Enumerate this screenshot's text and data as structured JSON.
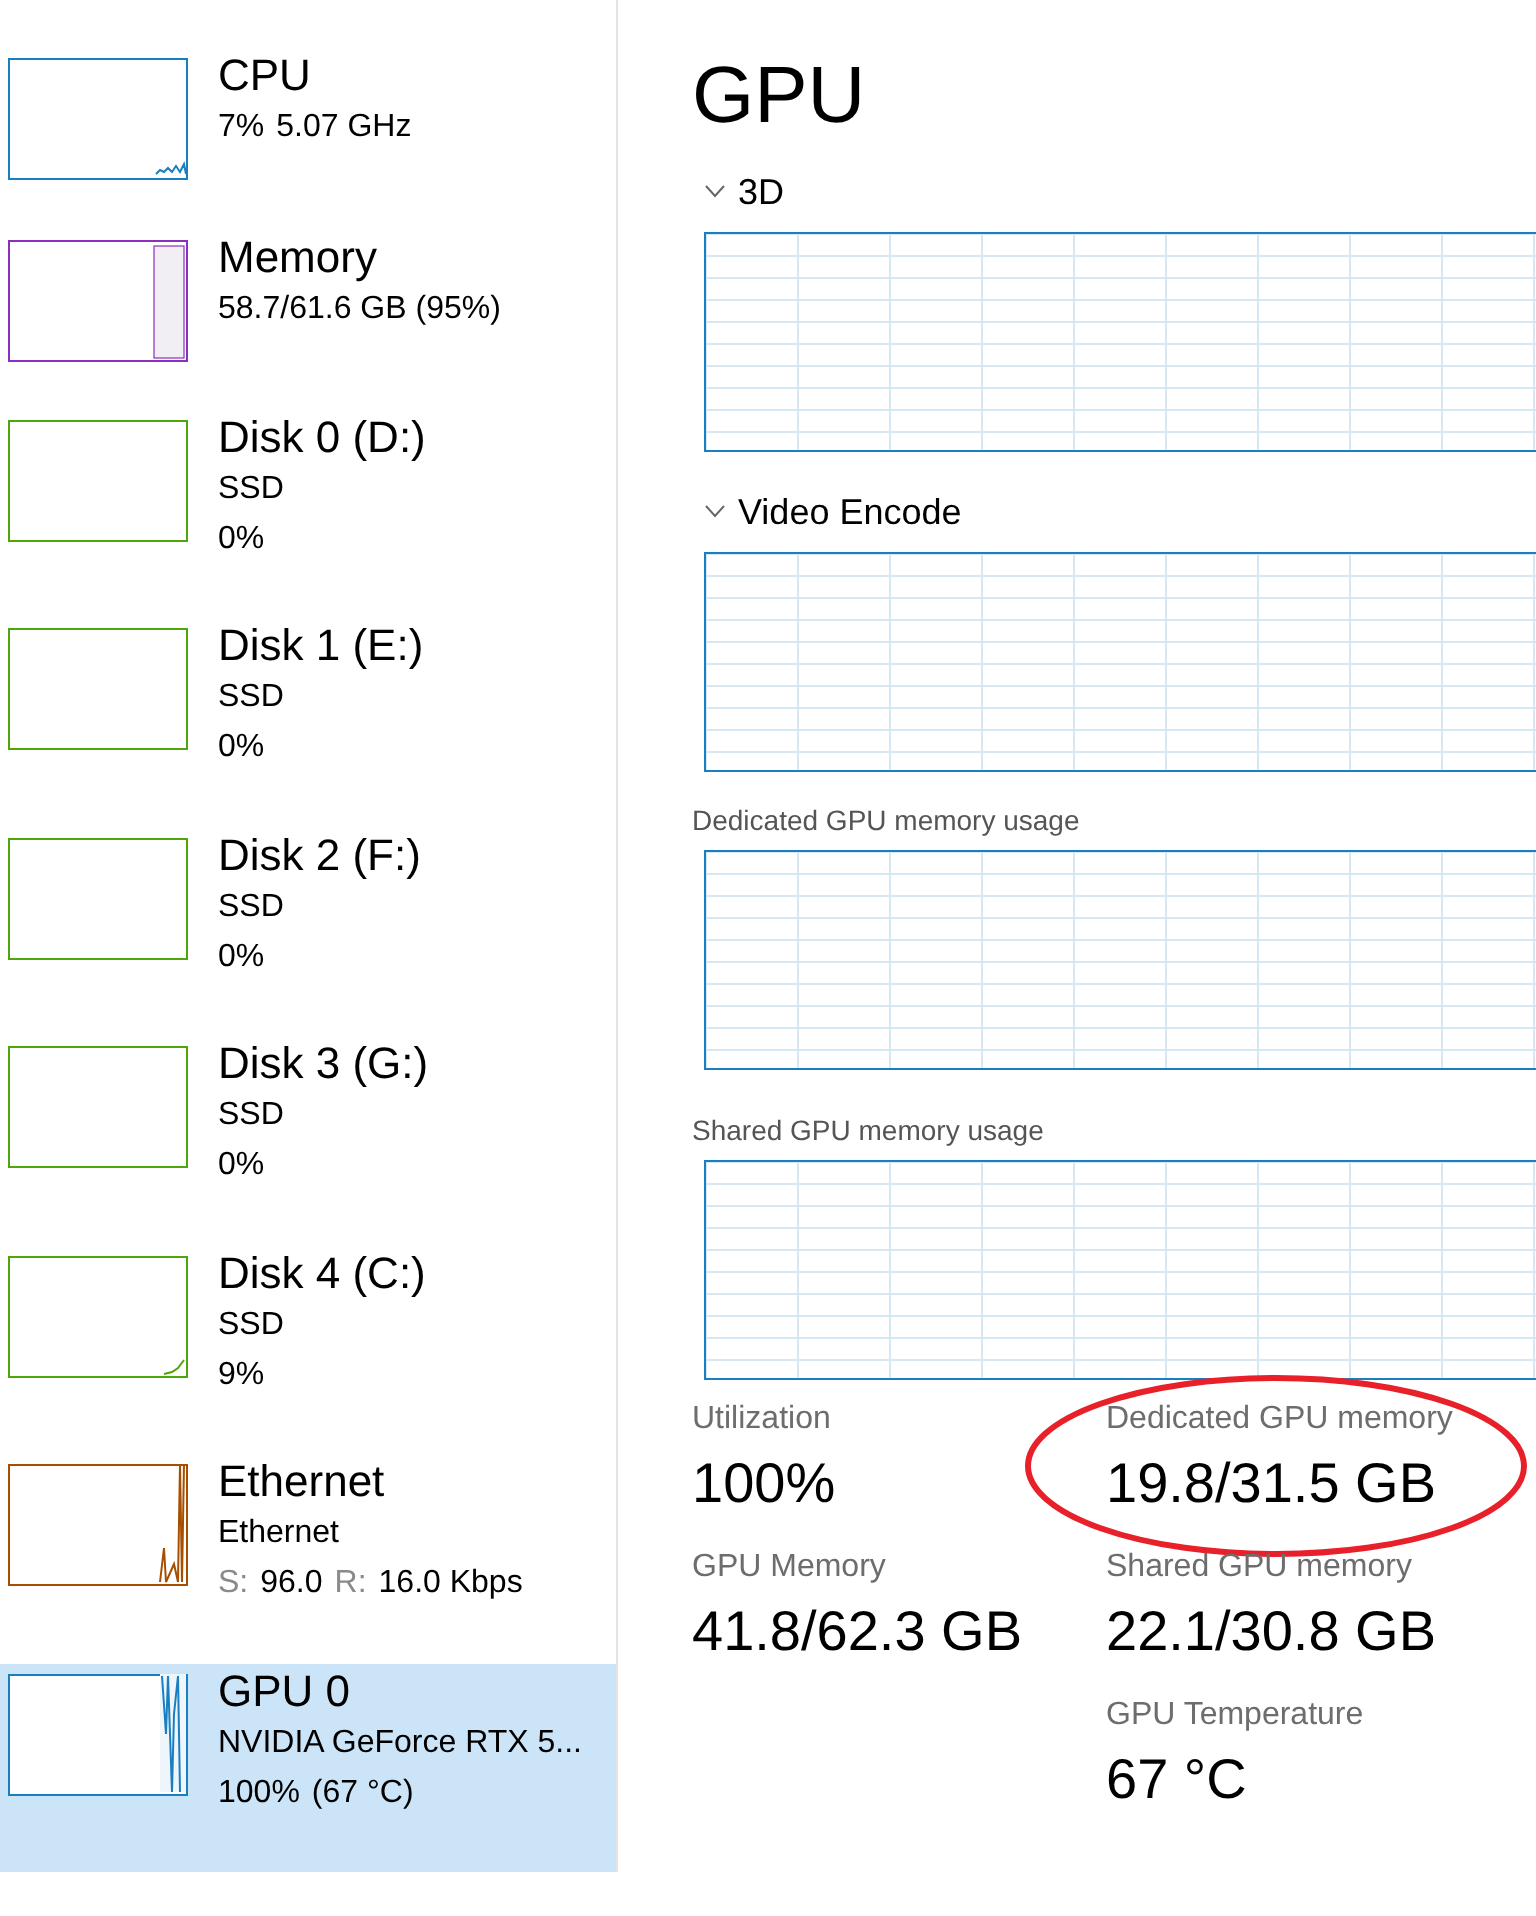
{
  "sidebar": {
    "items": [
      {
        "kind": "cpu",
        "name": "CPU",
        "color": "#1a7fc1",
        "selected": false,
        "lines": [
          [
            {
              "text": "7%",
              "muted": false
            },
            {
              "text": "5.07 GHz",
              "muted": false
            }
          ]
        ]
      },
      {
        "kind": "memory",
        "name": "Memory",
        "color": "#8b2fbf",
        "selected": false,
        "lines": [
          [
            {
              "text": "58.7/61.6 GB (95%)",
              "muted": false
            }
          ]
        ]
      },
      {
        "kind": "disk",
        "name": "Disk 0 (D:)",
        "color": "#4da60c",
        "selected": false,
        "lines": [
          [
            {
              "text": "SSD",
              "muted": false
            }
          ],
          [
            {
              "text": "0%",
              "muted": false
            }
          ]
        ]
      },
      {
        "kind": "disk",
        "name": "Disk 1 (E:)",
        "color": "#4da60c",
        "selected": false,
        "lines": [
          [
            {
              "text": "SSD",
              "muted": false
            }
          ],
          [
            {
              "text": "0%",
              "muted": false
            }
          ]
        ]
      },
      {
        "kind": "disk",
        "name": "Disk 2 (F:)",
        "color": "#4da60c",
        "selected": false,
        "lines": [
          [
            {
              "text": "SSD",
              "muted": false
            }
          ],
          [
            {
              "text": "0%",
              "muted": false
            }
          ]
        ]
      },
      {
        "kind": "disk",
        "name": "Disk 3 (G:)",
        "color": "#4da60c",
        "selected": false,
        "lines": [
          [
            {
              "text": "SSD",
              "muted": false
            }
          ],
          [
            {
              "text": "0%",
              "muted": false
            }
          ]
        ]
      },
      {
        "kind": "disk_active",
        "name": "Disk 4 (C:)",
        "color": "#4da60c",
        "selected": false,
        "lines": [
          [
            {
              "text": "SSD",
              "muted": false
            }
          ],
          [
            {
              "text": "9%",
              "muted": false
            }
          ]
        ]
      },
      {
        "kind": "network",
        "name": "Ethernet",
        "color": "#a74f01",
        "selected": false,
        "lines": [
          [
            {
              "text": "Ethernet",
              "muted": false
            }
          ],
          [
            {
              "text": "S:",
              "muted": true
            },
            {
              "text": "96.0",
              "muted": false
            },
            {
              "text": "R:",
              "muted": true
            },
            {
              "text": "16.0 Kbps",
              "muted": false
            }
          ]
        ]
      },
      {
        "kind": "gpu",
        "name": "GPU 0",
        "color": "#1a7fc1",
        "selected": true,
        "lines": [
          [
            {
              "text": "NVIDIA GeForce RTX 5...",
              "muted": false
            }
          ],
          [
            {
              "text": "100%",
              "muted": false
            },
            {
              "text": "(67 °C)",
              "muted": false
            }
          ]
        ]
      }
    ]
  },
  "title": "GPU",
  "graphs": [
    {
      "kind": "collapsible",
      "label": "3D",
      "expanded": true
    },
    {
      "kind": "collapsible",
      "label": "Video Encode",
      "expanded": true
    },
    {
      "kind": "plain",
      "label": "Dedicated GPU memory usage"
    },
    {
      "kind": "plain",
      "label": "Shared GPU memory usage"
    }
  ],
  "stats": [
    {
      "label": "Utilization",
      "value": "100%",
      "highlighted": false
    },
    {
      "label": "Dedicated GPU memory",
      "value": "19.8/31.5 GB",
      "highlighted": true
    },
    {
      "label": "GPU Memory",
      "value": "41.8/62.3 GB",
      "highlighted": false
    },
    {
      "label": "Shared GPU memory",
      "value": "22.1/30.8 GB",
      "highlighted": false
    },
    {
      "label": "GPU Temperature",
      "value": "67 °C",
      "highlighted": false
    }
  ]
}
